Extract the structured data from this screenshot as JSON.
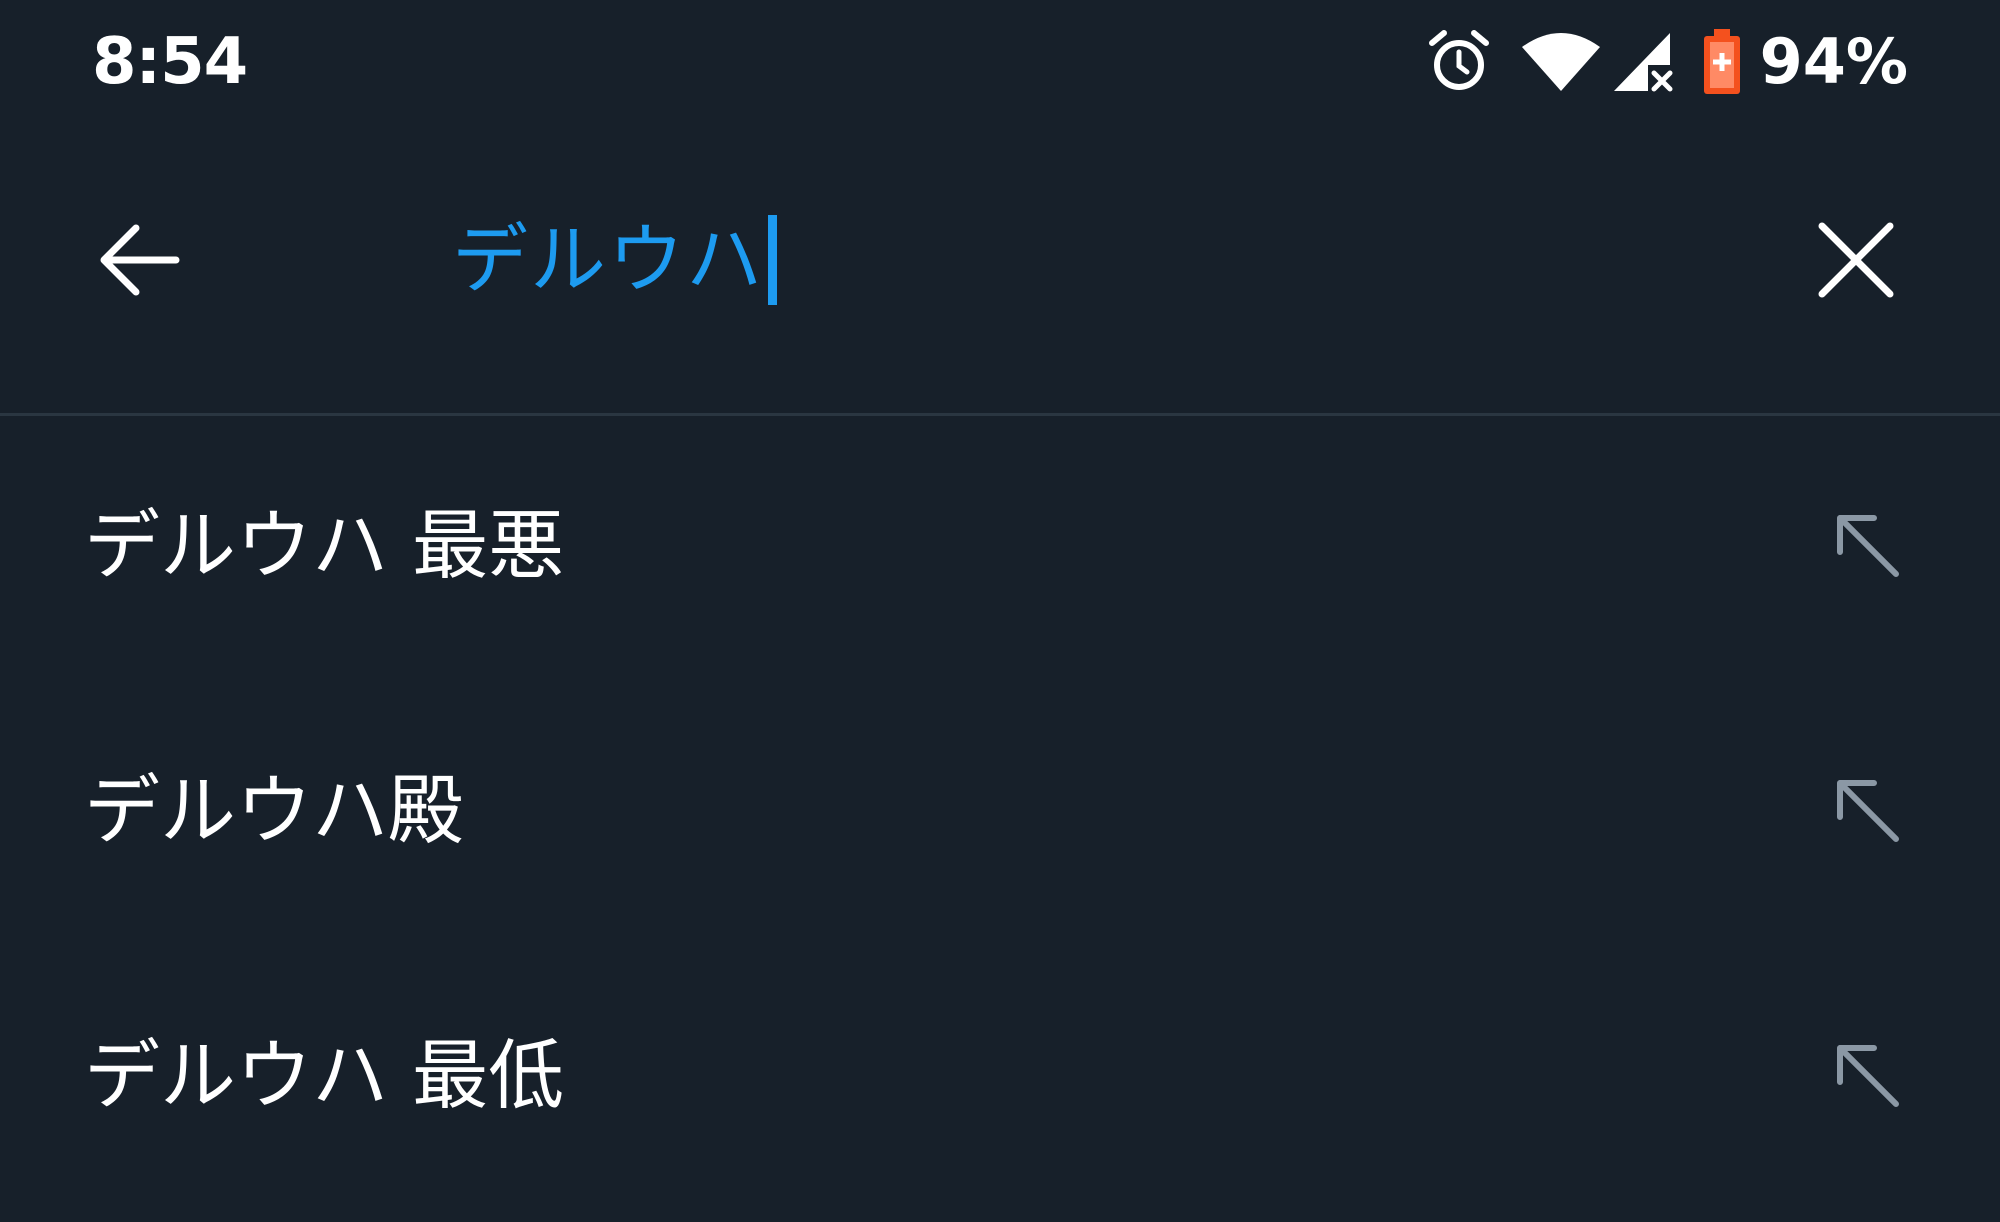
{
  "status_bar": {
    "time": "8:54",
    "battery_percent": "94%",
    "icons": [
      "alarm-icon",
      "wifi-icon",
      "signal-no-service-icon",
      "battery-charging-icon"
    ],
    "battery_color": "#f4511e"
  },
  "search": {
    "query": "デルウハ",
    "back_icon": "back-arrow-icon",
    "clear_icon": "close-icon",
    "accent_color": "#1d9bf0"
  },
  "suggestions": [
    {
      "label": "デルウハ 最悪",
      "icon": "fill-query-arrow-icon"
    },
    {
      "label": "デルウハ殿",
      "icon": "fill-query-arrow-icon"
    },
    {
      "label": "デルウハ 最低",
      "icon": "fill-query-arrow-icon"
    }
  ],
  "colors": {
    "background": "#17202a",
    "divider": "#2a3641",
    "secondary_icon": "#8b98a5"
  }
}
